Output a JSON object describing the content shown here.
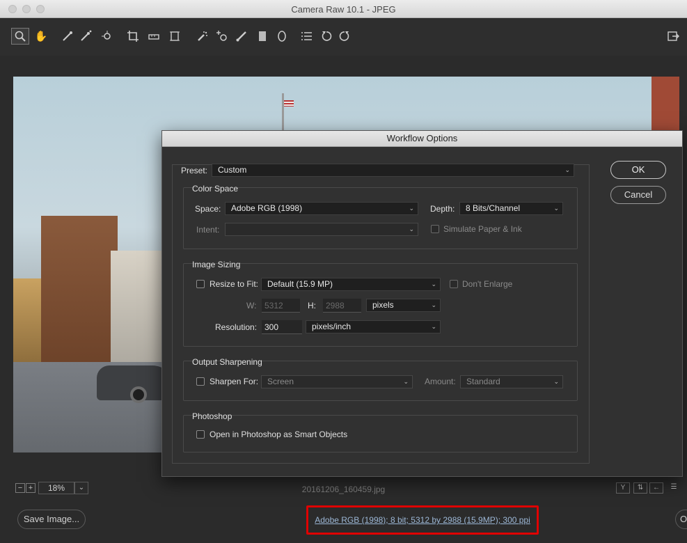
{
  "window": {
    "title": "Camera Raw 10.1  -  JPEG"
  },
  "toolbar": {
    "tools": [
      "zoom-icon",
      "hand-icon",
      "white-balance-icon",
      "color-sampler-icon",
      "targeted-adjustment-icon",
      "crop-icon",
      "straighten-icon",
      "transform-icon",
      "spot-removal-icon",
      "red-eye-icon",
      "adjustment-brush-icon",
      "graduated-filter-icon",
      "radial-filter-icon",
      "preferences-icon",
      "rotate-left-icon",
      "rotate-right-icon"
    ],
    "right_tool": "toggle-fullscreen-icon"
  },
  "status": {
    "zoom_minus": "−",
    "zoom_plus": "+",
    "zoom_level": "18%",
    "filename": "20161206_160459.jpg",
    "before_after": "Y"
  },
  "footer": {
    "save_button": "Save Image...",
    "workflow_link": "Adobe RGB (1998); 8 bit; 5312 by 2988 (15.9MP); 300 ppi",
    "cut_button": "O"
  },
  "dialog": {
    "title": "Workflow Options",
    "preset_label": "Preset:",
    "preset_value": "Custom",
    "ok": "OK",
    "cancel": "Cancel",
    "color_space": {
      "title": "Color Space",
      "space_label": "Space:",
      "space_value": "Adobe RGB (1998)",
      "depth_label": "Depth:",
      "depth_value": "8 Bits/Channel",
      "intent_label": "Intent:",
      "intent_value": "",
      "simulate_label": "Simulate Paper & Ink"
    },
    "image_sizing": {
      "title": "Image Sizing",
      "resize_label": "Resize to Fit:",
      "resize_value": "Default  (15.9 MP)",
      "dont_enlarge": "Don't Enlarge",
      "w_label": "W:",
      "w_value": "5312",
      "h_label": "H:",
      "h_value": "2988",
      "unit_value": "pixels",
      "resolution_label": "Resolution:",
      "resolution_value": "300",
      "resolution_unit": "pixels/inch"
    },
    "output_sharpening": {
      "title": "Output Sharpening",
      "sharpen_label": "Sharpen For:",
      "sharpen_value": "Screen",
      "amount_label": "Amount:",
      "amount_value": "Standard"
    },
    "photoshop": {
      "title": "Photoshop",
      "smart_objects_label": "Open in Photoshop as Smart Objects"
    }
  }
}
